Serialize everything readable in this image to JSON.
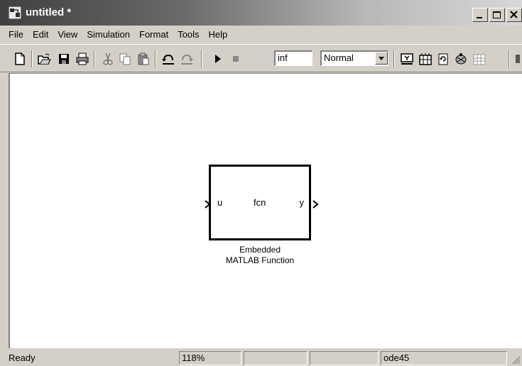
{
  "window": {
    "title": "untitled *"
  },
  "menu": {
    "items": [
      "File",
      "Edit",
      "View",
      "Simulation",
      "Format",
      "Tools",
      "Help"
    ]
  },
  "toolbar": {
    "stop_time": "inf",
    "sim_mode": "Normal",
    "icons": [
      "new-icon",
      "open-icon",
      "save-icon",
      "print-icon",
      "cut-icon",
      "copy-icon",
      "paste-icon",
      "undo-icon",
      "redo-icon",
      "play-icon",
      "stop-icon",
      "build-icon",
      "library-icon",
      "refresh-icon",
      "debug-icon",
      "explorer-icon"
    ]
  },
  "block": {
    "function_name": "fcn",
    "input_port": "u",
    "output_port": "y",
    "caption_line1": "Embedded",
    "caption_line2": "MATLAB Function"
  },
  "status": {
    "state": "Ready",
    "zoom": "118%",
    "solver": "ode45"
  },
  "colors": {
    "face": "#d4d0c8",
    "canvas": "#ffffff",
    "title_dark": "#404040"
  }
}
